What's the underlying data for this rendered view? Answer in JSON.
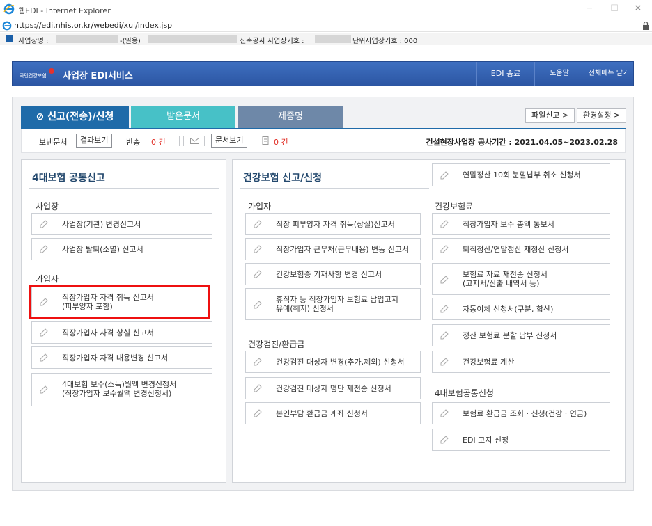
{
  "window": {
    "title": "웹EDI - Internet Explorer",
    "url": "https://edi.nhis.or.kr/webedi/xui/index.jsp"
  },
  "infobar": {
    "biz_name_label": "사업장명 :",
    "biz_name_suffix": "-(일용)",
    "new_site_label": "신축공사 사업장기호 :",
    "unit_label": "단위사업장기호 : 000"
  },
  "header": {
    "logo_text": "국민건강보험",
    "title": "사업장 EDI서비스",
    "end_label": "EDI 종료",
    "help_label": "도움말",
    "close_menu_label": "전체메뉴 닫기"
  },
  "tabs": [
    {
      "label": "⊘ 신고(전송)/신청"
    },
    {
      "label": "받은문서"
    },
    {
      "label": "제증명"
    }
  ],
  "toolbar": {
    "file_report": "파일신고 >",
    "env_settings": "환경설정 >"
  },
  "status": {
    "sent_label": "보낸문서",
    "result_btn": "결과보기",
    "return_label": "반송",
    "return_count": "0 건",
    "doc_view_btn": "문서보기",
    "doc_count": "0 건",
    "period": "건설현장사업장 공사기간 : 2021.04.05~2023.02.28"
  },
  "left_panel": {
    "title": "4대보험 공통신고",
    "sections": [
      {
        "label": "사업장",
        "items": [
          "사업장(기관) 변경신고서",
          "사업장 탈퇴(소멸) 신고서"
        ]
      },
      {
        "label": "가입자",
        "items": [
          [
            "직장가입자 자격 취득 신고서",
            "(피부양자 포함)"
          ],
          [
            "직장가입자 자격 상실 신고서"
          ],
          [
            "직장가입자 자격 내용변경 신고서"
          ],
          [
            "4대보험 보수(소득)월액 변경신청서",
            "(직장가입자 보수월액 변경신청서)"
          ]
        ]
      }
    ]
  },
  "right_panel": {
    "title": "건강보험 신고/신청",
    "top_button": "연말정산 10회 분할납부 취소 신청서",
    "col1_sections": [
      {
        "label": "가입자",
        "items": [
          [
            "직장 피부양자 자격 취득(상실)신고서"
          ],
          [
            "직장가입자 근무처(근무내용) 변동 신고서"
          ],
          [
            "건강보험증 기재사항 변경 신고서"
          ],
          [
            "휴직자 등 직장가입자 보험료 납입고지",
            "유예(해지) 신청서"
          ]
        ]
      },
      {
        "label": "건강검진/환급금",
        "items": [
          [
            "건강검진 대상자 변경(추가,제외) 신청서"
          ],
          [
            "건강검진 대상자 명단 재전송 신청서"
          ],
          [
            "본인부담 환급금 계좌 신청서"
          ]
        ]
      }
    ],
    "col2_sections": [
      {
        "label": "건강보험료",
        "items": [
          [
            "직장가입자 보수 총액 통보서"
          ],
          [
            "퇴직정산/연말정산 재정산 신청서"
          ],
          [
            "보험료 자료 재전송 신청서",
            "(고지서/산출 내역서 등)"
          ],
          [
            "자동이체 신청서(구분, 합산)"
          ],
          [
            "정산 보험료 분할 납부 신청서"
          ],
          [
            "건강보험료 계산"
          ]
        ]
      },
      {
        "label": "4대보험공통신청",
        "items": [
          [
            "보험료 환급금 조회 · 신청(건강 · 연금)"
          ],
          [
            "EDI 고지 신청"
          ]
        ]
      }
    ]
  },
  "colors": {
    "header_blue": "#2c56a3",
    "tab_active": "#1f6ba9",
    "tab_recv": "#47c1c7",
    "tab_cert": "#6e88a8",
    "highlight": "#ee1010",
    "red_count": "#e0261d"
  }
}
